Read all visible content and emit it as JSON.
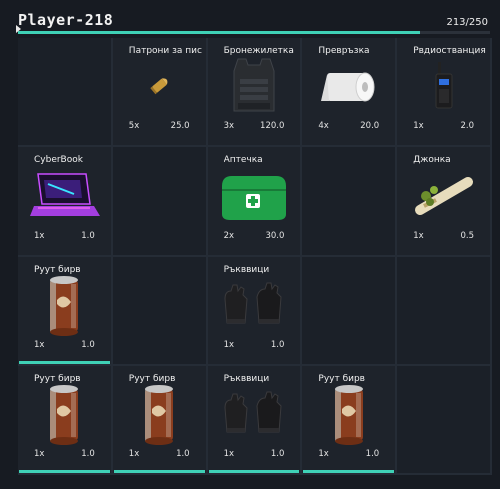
{
  "player": {
    "name": "Player-218",
    "capacity_text": "213/250",
    "capacity_fraction": 0.852
  },
  "colors": {
    "accent": "#3fd1b6",
    "background": "#171b22",
    "slot": "#1e232b"
  },
  "slots": [
    {
      "filled": false
    },
    {
      "filled": true,
      "name": "Патрони за пис..",
      "qty": "5x",
      "weight": "25.0",
      "icon": "bullet-icon"
    },
    {
      "filled": true,
      "name": "Бронежилетка",
      "qty": "3x",
      "weight": "120.0",
      "icon": "body-armor-icon"
    },
    {
      "filled": true,
      "name": "Превръзка",
      "qty": "4x",
      "weight": "20.0",
      "icon": "bandage-roll-icon"
    },
    {
      "filled": true,
      "name": "Рвдиостванция",
      "qty": "1x",
      "weight": "2.0",
      "icon": "radio-icon"
    },
    {
      "filled": true,
      "name": "CyberBook",
      "qty": "1x",
      "weight": "1.0",
      "icon": "laptop-icon"
    },
    {
      "filled": false
    },
    {
      "filled": true,
      "name": "Аптечка",
      "qty": "2x",
      "weight": "30.0",
      "icon": "first-aid-kit-icon"
    },
    {
      "filled": false
    },
    {
      "filled": true,
      "name": "Джонка",
      "qty": "1x",
      "weight": "0.5",
      "icon": "joint-icon"
    },
    {
      "filled": true,
      "name": "Руут бирв",
      "qty": "1x",
      "weight": "1.0",
      "icon": "beer-can-icon",
      "bar": true
    },
    {
      "filled": false
    },
    {
      "filled": true,
      "name": "Ръкввици",
      "qty": "1x",
      "weight": "1.0",
      "icon": "gloves-icon"
    },
    {
      "filled": false
    },
    {
      "filled": false
    },
    {
      "filled": true,
      "name": "Руут бирв",
      "qty": "1x",
      "weight": "1.0",
      "icon": "beer-can-icon",
      "bar": true
    },
    {
      "filled": true,
      "name": "Руут бирв",
      "qty": "1x",
      "weight": "1.0",
      "icon": "beer-can-icon",
      "bar": true
    },
    {
      "filled": true,
      "name": "Ръкввици",
      "qty": "1x",
      "weight": "1.0",
      "icon": "gloves-icon",
      "bar": true
    },
    {
      "filled": true,
      "name": "Руут бирв",
      "qty": "1x",
      "weight": "1.0",
      "icon": "beer-can-icon",
      "bar": true
    },
    {
      "filled": false
    }
  ]
}
